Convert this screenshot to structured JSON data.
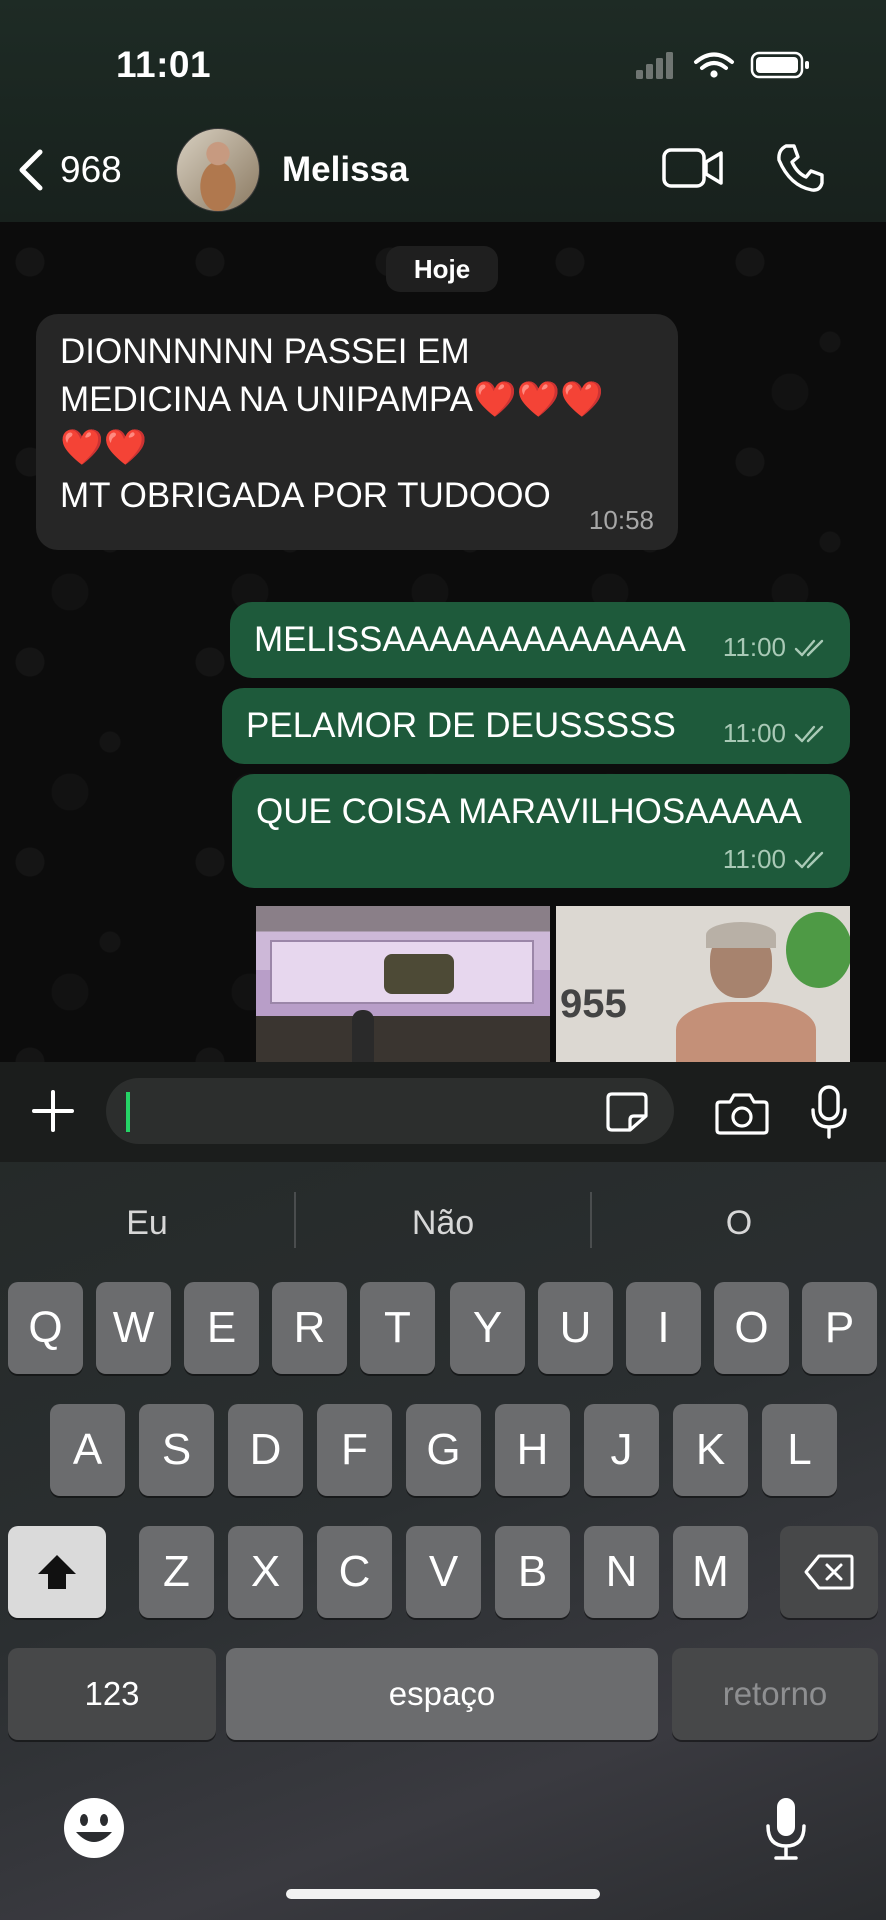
{
  "status_bar": {
    "time": "11:01"
  },
  "header": {
    "back_count": "968",
    "contact_name": "Melissa"
  },
  "chat": {
    "date_chip": "Hoje",
    "incoming": {
      "lines": [
        "DIONNNNNN PASSEI EM",
        "MEDICINA NA UNIPAMPA❤️❤️❤️",
        "❤️❤️",
        "MT OBRIGADA POR TUDOOO"
      ],
      "time": "10:58"
    },
    "outgoing": [
      {
        "text": "MELISSAAAAAAAAAAAAA",
        "time": "11:00"
      },
      {
        "text": "PELAMOR DE DEUSSSSS",
        "time": "11:00"
      },
      {
        "text": "QUE COISA MARAVILHOSAAAAA",
        "time": "11:00"
      }
    ],
    "media_caption_text": "955"
  },
  "composer": {
    "value": "",
    "placeholder": ""
  },
  "keyboard": {
    "suggestions": [
      "Eu",
      "Não",
      "O"
    ],
    "row1": [
      "Q",
      "W",
      "E",
      "R",
      "T",
      "Y",
      "U",
      "I",
      "O",
      "P"
    ],
    "row2": [
      "A",
      "S",
      "D",
      "F",
      "G",
      "H",
      "J",
      "K",
      "L"
    ],
    "row3": [
      "Z",
      "X",
      "C",
      "V",
      "B",
      "N",
      "M"
    ],
    "numbers_label": "123",
    "space_label": "espaço",
    "return_label": "retorno"
  },
  "colors": {
    "outgoing_bubble": "#1e5a3b",
    "incoming_bubble": "#262626",
    "accent": "#25d366"
  },
  "icons": [
    "back-chevron-icon",
    "video-call-icon",
    "phone-icon",
    "plus-icon",
    "sticker-icon",
    "camera-icon",
    "microphone-icon",
    "shift-icon",
    "delete-icon",
    "emoji-icon",
    "dictation-icon",
    "signal-icon",
    "wifi-icon",
    "battery-icon",
    "double-check-icon"
  ]
}
